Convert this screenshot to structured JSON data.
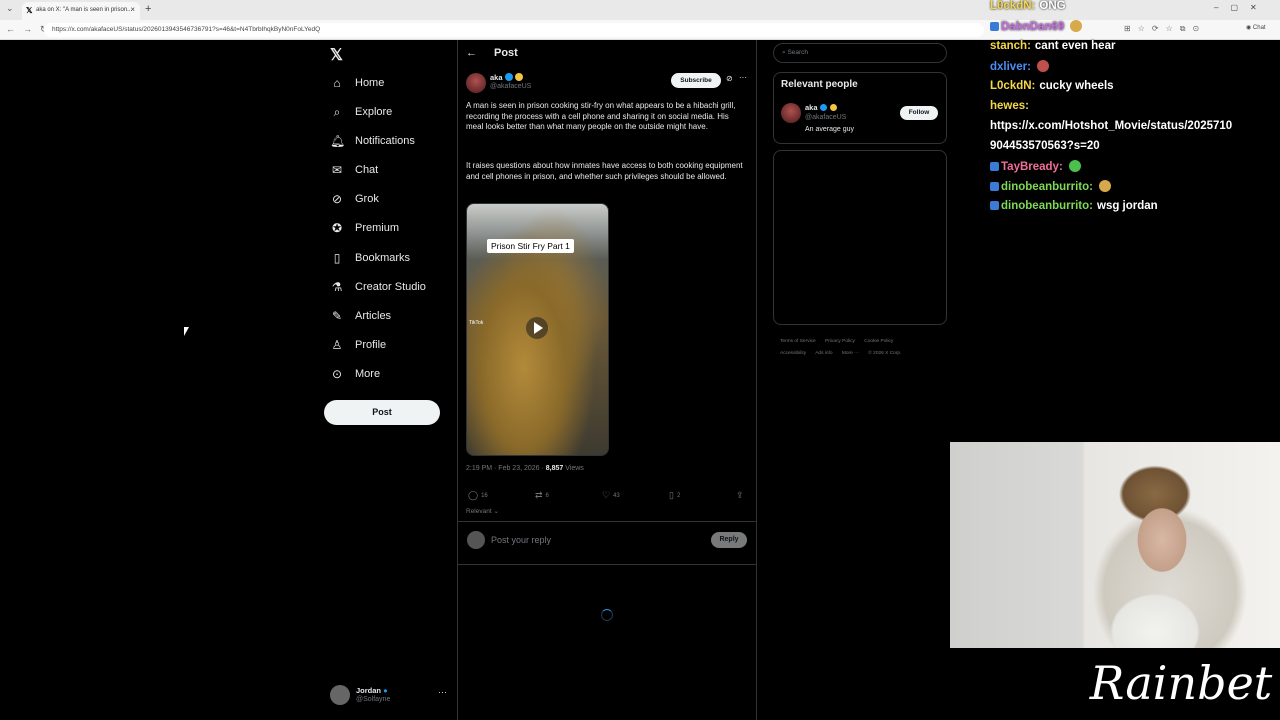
{
  "browser": {
    "tab_title": "aka on X: \"A man is seen in prison...",
    "url": "https://x.com/akafaceUS/status/2026013943546736791?s=46&t=N4TbrbIhqkByN0nFoLYedQ",
    "new_tab_icon": "+",
    "close_icon": "×"
  },
  "nav": {
    "items": [
      {
        "label": "Home",
        "icon": "home-icon"
      },
      {
        "label": "Explore",
        "icon": "search-icon"
      },
      {
        "label": "Notifications",
        "icon": "bell-icon"
      },
      {
        "label": "Chat",
        "icon": "chat-icon"
      },
      {
        "label": "Grok",
        "icon": "grok-icon"
      },
      {
        "label": "Premium",
        "icon": "premium-icon"
      },
      {
        "label": "Bookmarks",
        "icon": "bookmark-icon"
      },
      {
        "label": "Creator Studio",
        "icon": "flask-icon"
      },
      {
        "label": "Articles",
        "icon": "article-icon"
      },
      {
        "label": "Profile",
        "icon": "person-icon"
      },
      {
        "label": "More",
        "icon": "more-icon"
      }
    ],
    "post_button": "Post",
    "account": {
      "name": "Jordan",
      "handle": "@Solfayne",
      "more": "···"
    }
  },
  "post": {
    "header": "Post",
    "author_name": "aka",
    "author_handle": "@akafaceUS",
    "subscribe": "Subscribe",
    "text1": "A man is seen in prison cooking stir-fry on what appears to be a hibachi grill, recording the process with a cell phone and sharing it on social media. His meal looks better than what many people on the outside might have.",
    "text2": "It raises questions about how inmates have access to both cooking equipment and cell phones in prison, and whether such privileges should be allowed.",
    "media_label": "Prison Stir Fry Part 1",
    "tiktok": "TikTok",
    "timestamp": "2:19 PM · Feb 23, 2026 · ",
    "views_count": "8,857",
    "views_label": " Views",
    "actions": {
      "replies": "16",
      "reposts": "6",
      "likes": "43",
      "bookmarks": "2"
    },
    "sort": "Relevant ⌄",
    "reply_placeholder": "Post your reply",
    "reply_button": "Reply"
  },
  "sidebar": {
    "search_placeholder": "Search",
    "relevant_title": "Relevant people",
    "person": {
      "name": "aka",
      "handle": "@akafaceUS",
      "bio": "An average guy",
      "follow": "Follow"
    },
    "footer": [
      "Terms of Service",
      "Privacy Policy",
      "Cookie Policy",
      "Accessibility",
      "Ads info",
      "More ···",
      "© 2026 X Corp."
    ]
  },
  "chat": [
    {
      "user": "L0ckdN:",
      "text": "ONG",
      "color": "#f5d84a",
      "badge": false
    },
    {
      "user": "DabnDan69",
      "text": "",
      "color": "#c56de0",
      "badge": true,
      "emote": "#d6a94a"
    },
    {
      "user": "stanch:",
      "text": "cant even hear",
      "color": "#f5d84a",
      "badge": false
    },
    {
      "user": "dxliver:",
      "text": "",
      "color": "#4d8df5",
      "badge": false,
      "emote": "#c0504d"
    },
    {
      "user": "L0ckdN:",
      "text": "cucky wheels",
      "color": "#f5d84a",
      "badge": false
    },
    {
      "user": "hewes:",
      "text": "",
      "color": "#f5d84a",
      "badge": false
    },
    {
      "user": "",
      "text": "https://x.com/Hotshot_Movie/status/2025710",
      "color": "#ffffff",
      "badge": false
    },
    {
      "user": "",
      "text": "904453570563?s=20",
      "color": "#ffffff",
      "badge": false
    },
    {
      "user": "TayBready:",
      "text": "",
      "color": "#f06e9a",
      "badge": true,
      "emote": "#4cc04c"
    },
    {
      "user": "dinobeanburrito:",
      "text": "",
      "color": "#7ed957",
      "badge": true,
      "emote": "#d6a94a"
    },
    {
      "user": "dinobeanburrito:",
      "text": "wsg jordan",
      "color": "#7ed957",
      "badge": true
    }
  ],
  "overlay": {
    "logo": "Rainbet"
  }
}
